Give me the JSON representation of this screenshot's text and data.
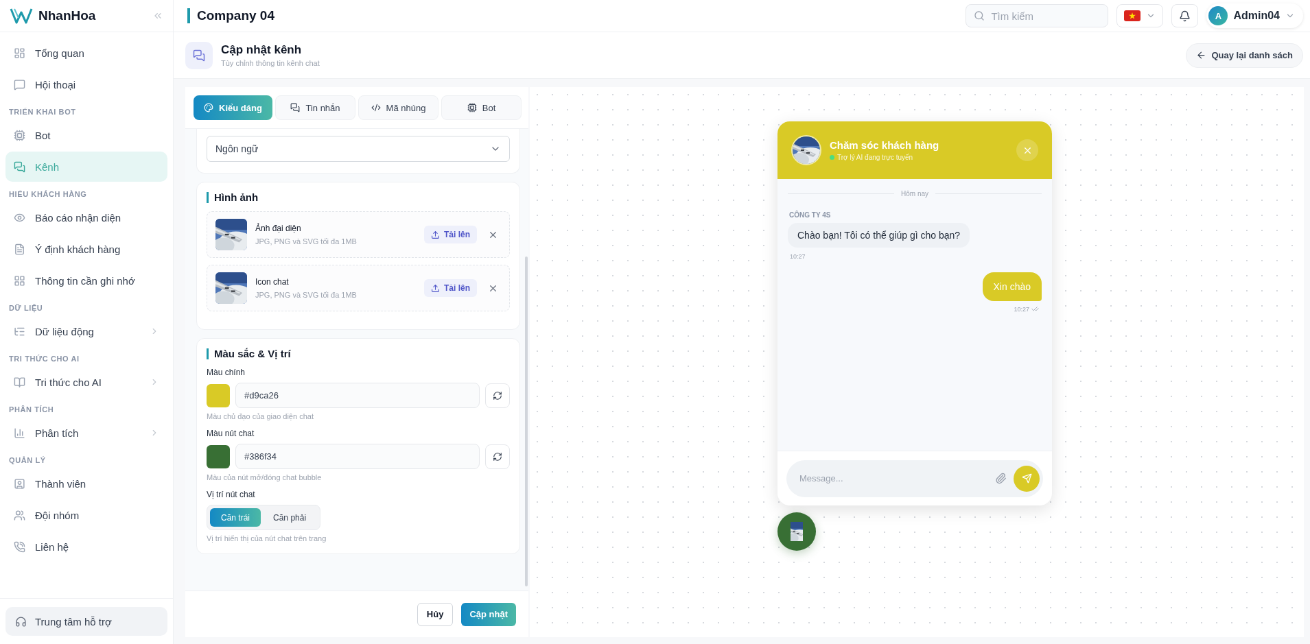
{
  "brand": {
    "name": "NhanHoa"
  },
  "sidebar": {
    "groups": [
      {
        "items": [
          {
            "label": "Tổng quan",
            "selected": false,
            "expandable": false
          },
          {
            "label": "Hội thoại",
            "selected": false,
            "expandable": false
          }
        ]
      },
      {
        "heading": "TRIỂN KHAI BOT",
        "items": [
          {
            "label": "Bot",
            "selected": false,
            "expandable": false
          },
          {
            "label": "Kênh",
            "selected": true,
            "expandable": false
          }
        ]
      },
      {
        "heading": "HIỂU KHÁCH HÀNG",
        "items": [
          {
            "label": "Báo cáo nhận diện",
            "selected": false,
            "expandable": false
          },
          {
            "label": "Ý định khách hàng",
            "selected": false,
            "expandable": false
          },
          {
            "label": "Thông tin cần ghi nhớ",
            "selected": false,
            "expandable": false
          }
        ]
      },
      {
        "heading": "DỮ LIỆU",
        "items": [
          {
            "label": "Dữ liệu động",
            "selected": false,
            "expandable": true
          }
        ]
      },
      {
        "heading": "TRI THỨC CHO AI",
        "items": [
          {
            "label": "Tri thức cho AI",
            "selected": false,
            "expandable": true
          }
        ]
      },
      {
        "heading": "PHÂN TÍCH",
        "items": [
          {
            "label": "Phân tích",
            "selected": false,
            "expandable": true
          }
        ]
      },
      {
        "heading": "QUẢN LÝ",
        "items": [
          {
            "label": "Thành viên",
            "selected": false,
            "expandable": false
          },
          {
            "label": "Đội nhóm",
            "selected": false,
            "expandable": false
          },
          {
            "label": "Liên hệ",
            "selected": false,
            "expandable": false
          }
        ]
      }
    ],
    "support": "Trung tâm hỗ trợ"
  },
  "topbar": {
    "company": "Company 04",
    "search": {
      "placeholder": "Tìm kiếm"
    },
    "user": {
      "initial": "A",
      "name": "Admin04"
    }
  },
  "page": {
    "title": "Cập nhật kênh",
    "subtitle": "Tùy chỉnh thông tin kênh chat",
    "back": "Quay lại danh sách"
  },
  "tabs": [
    {
      "label": "Kiểu dáng",
      "selected": true
    },
    {
      "label": "Tin nhắn",
      "selected": false
    },
    {
      "label": "Mã nhúng",
      "selected": false
    },
    {
      "label": "Bot",
      "selected": false
    }
  ],
  "language_select": {
    "value": "Ngôn ngữ"
  },
  "images": {
    "title": "Hình ảnh",
    "items": [
      {
        "name": "Ảnh đại diện",
        "hint": "JPG, PNG và SVG tối đa 1MB",
        "upload": "Tải lên"
      },
      {
        "name": "Icon chat",
        "hint": "JPG, PNG và SVG tối đa 1MB",
        "upload": "Tải lên"
      }
    ]
  },
  "colors": {
    "title": "Màu sắc & Vị trí",
    "fields": [
      {
        "label": "Màu chính",
        "value": "#d9ca26",
        "color": "#d9ca26",
        "hint": "Màu chủ đạo của giao diện chat"
      },
      {
        "label": "Màu nút chat",
        "value": "#386f34",
        "color": "#386f34",
        "hint": "Màu của nút mở/đóng chat bubble"
      }
    ],
    "position": {
      "label": "Vị trí nút chat",
      "options": [
        {
          "label": "Căn trái",
          "selected": true
        },
        {
          "label": "Căn phải",
          "selected": false
        }
      ],
      "hint": "Vị trí hiển thị của nút chat trên trang"
    }
  },
  "footer": {
    "cancel": "Hủy",
    "submit": "Cập nhật"
  },
  "preview": {
    "title": "Chăm sóc khách hàng",
    "status": "Trợ lý AI đang trực tuyến",
    "online": true,
    "date": "Hôm nay",
    "messages": [
      {
        "kind": "bot",
        "sender": "CÔNG TY 4S",
        "text": "Chào bạn! Tôi có thể giúp gì cho bạn?",
        "time": "10:27"
      },
      {
        "kind": "user",
        "text": "Xin chào",
        "time": "10:27",
        "read": true
      }
    ],
    "input": {
      "placeholder": "Message..."
    }
  }
}
